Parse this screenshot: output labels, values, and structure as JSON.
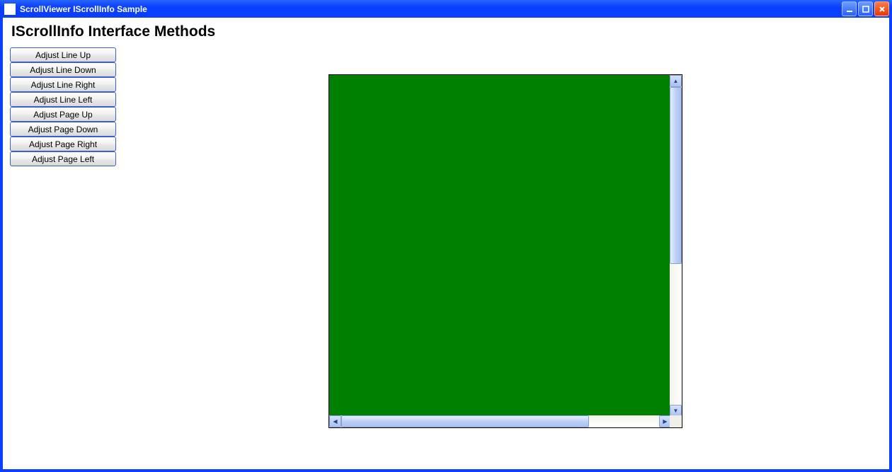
{
  "window": {
    "title": "ScrollViewer IScrollInfo Sample"
  },
  "page": {
    "heading": "IScrollInfo Interface Methods"
  },
  "buttons": [
    "Adjust Line Up",
    "Adjust Line Down",
    "Adjust Line Right",
    "Adjust Line Left",
    "Adjust Page Up",
    "Adjust Page Down",
    "Adjust Page Right",
    "Adjust Page Left"
  ],
  "colors": {
    "content_fill": "#008000",
    "titlebar": "#0a3fff"
  }
}
